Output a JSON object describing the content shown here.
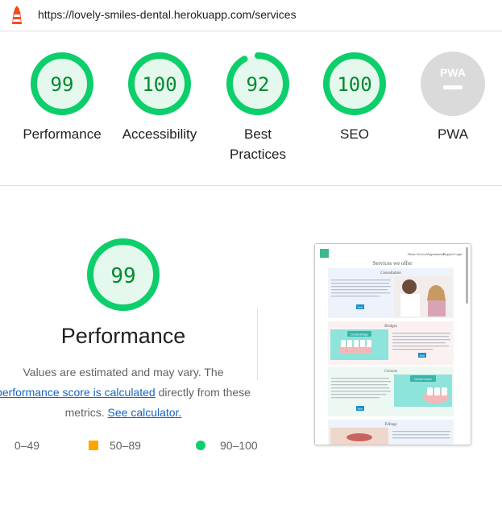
{
  "address_bar": {
    "url": "https://lovely-smiles-dental.herokuapp.com/services",
    "icon": "lighthouse-icon"
  },
  "categories": [
    {
      "score": "99",
      "label": "Performance",
      "value": 0.99,
      "color": "#0cce6b"
    },
    {
      "score": "100",
      "label": "Accessibility",
      "value": 1.0,
      "color": "#0cce6b"
    },
    {
      "score": "92",
      "label": "Best Practices",
      "value": 0.92,
      "color": "#0cce6b"
    },
    {
      "score": "100",
      "label": "SEO",
      "value": 1.0,
      "color": "#0cce6b"
    },
    {
      "label": "PWA",
      "badge": "PWA",
      "color": "#cccccc"
    }
  ],
  "performance": {
    "score": "99",
    "value": 0.99,
    "title": "Performance",
    "desc_line1": "Values are estimated and may vary. The",
    "desc_link1": "performance score is calculated",
    "desc_mid": " directly from these",
    "desc_line3": "metrics. ",
    "desc_link2": "See calculator."
  },
  "legend": {
    "fail": "0–49",
    "average": "50–89",
    "pass": "90–100",
    "colors": {
      "fail": "#ff4e42",
      "average": "#ffa400",
      "pass": "#0cce6b"
    }
  },
  "screenshot": {
    "nav": [
      "Home",
      "Services",
      "Appointment",
      "Register",
      "Login"
    ],
    "heading": "Services we offer",
    "sections": [
      "Consultation",
      "Bridges",
      "Crowns",
      "Fillings"
    ],
    "badges": {
      "bridges": "Dental Bridge",
      "crowns": "Dental Crown"
    },
    "button_label": "Book"
  }
}
